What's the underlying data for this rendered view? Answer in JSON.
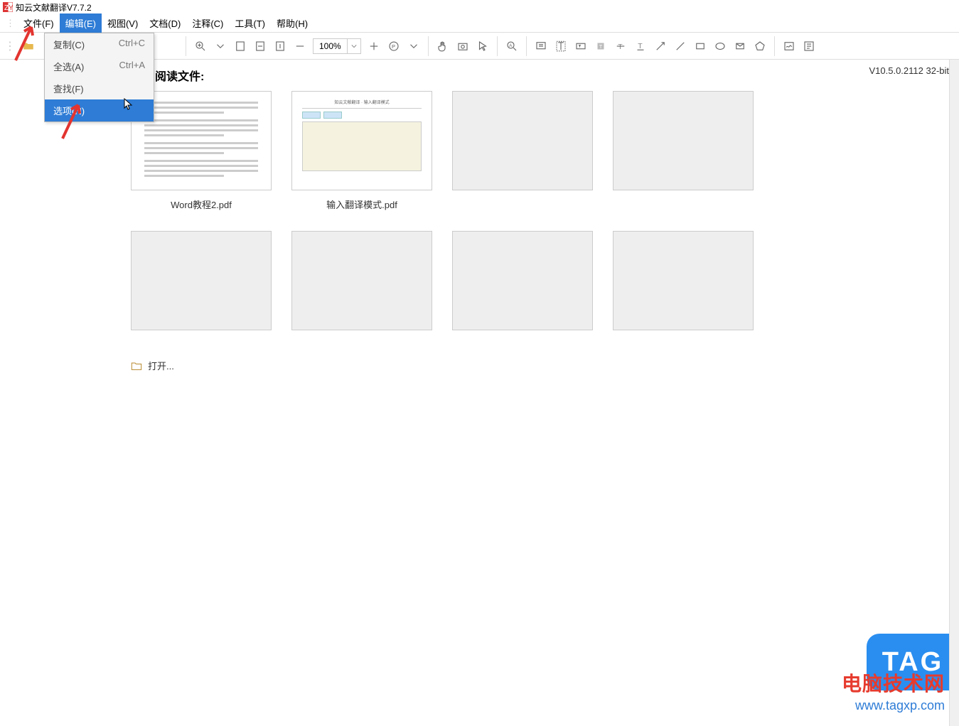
{
  "app": {
    "title": "知云文献翻译V7.7.2"
  },
  "menu": {
    "file": "文件(F)",
    "edit": "编辑(E)",
    "view": "视图(V)",
    "document": "文档(D)",
    "annotation": "注释(C)",
    "tool": "工具(T)",
    "help": "帮助(H)"
  },
  "dropdown": {
    "copy": {
      "label": "复制(C)",
      "shortcut": "Ctrl+C"
    },
    "selectall": {
      "label": "全选(A)",
      "shortcut": "Ctrl+A"
    },
    "find": {
      "label": "查找(F)",
      "shortcut": ""
    },
    "options": {
      "label": "选项(N)",
      "shortcut": ""
    }
  },
  "toolbar": {
    "zoom": "100%"
  },
  "version": "V10.5.0.2112 32-bit",
  "section_title": "阅读文件:",
  "files": {
    "f1": "Word教程2.pdf",
    "f2": "输入翻译模式.pdf"
  },
  "open_label": "打开...",
  "watermark": {
    "line1": "电脑技术网",
    "line2": "www.tagxp.com",
    "badge": "TAG"
  }
}
